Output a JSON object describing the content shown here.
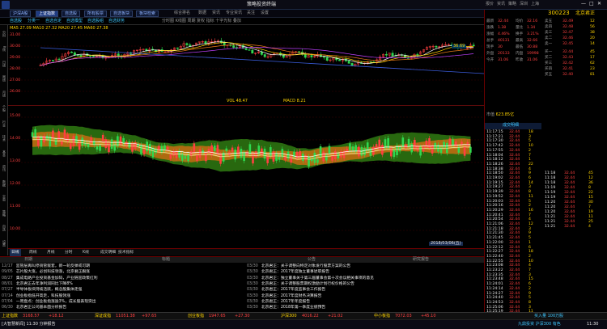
{
  "title_bar": {
    "app_title": "策略投资终端",
    "menus": [
      "报价",
      "资讯",
      "策略",
      "深圳",
      "上海"
    ]
  },
  "toolbar": {
    "buttons": [
      "沪深A股",
      "上证指数",
      "自选股",
      "所有股票",
      "自选板块",
      "板块检索"
    ],
    "active_index": 1,
    "right_items": [
      "综合排名",
      "数据",
      "资讯",
      "专业资讯",
      "关注",
      "设置"
    ]
  },
  "toolbar2": {
    "items": [
      "自选股",
      "分类一",
      "自选自定",
      "自选模型",
      "自选股组",
      "自选财务"
    ],
    "info": "分时图 K线图 周期 复权 指标 十字光标 叠加"
  },
  "left_panel": {
    "items": [
      "分时",
      "K线",
      "日线",
      "周线",
      "月线",
      "个股",
      "行业",
      "技术",
      "基本",
      "资讯",
      "数据",
      "交易",
      "策略",
      "自选",
      "设置"
    ]
  },
  "chart": {
    "indicator_text": "MA5 27.09 MA10 27.32 MA20 27.45 MA60 27.38",
    "top_right_value": "36.69",
    "mid_label": "VOL 48.47",
    "mid_label2": "MACD 8.21",
    "bottom_label": "2018/03/06(五)",
    "left_ticks": [
      "31.00",
      "30.00",
      "29.00",
      "28.00",
      "27.00",
      "26.00"
    ],
    "main_ticks": [
      "15.00",
      "14.00",
      "13.00",
      "12.00",
      "11.00",
      "10.00"
    ]
  },
  "bottom_tabs": [
    "日线",
    "周线",
    "月线",
    "分时",
    "K线",
    "成交明细",
    "技术指标"
  ],
  "right_panel": {
    "code": "300223",
    "name": "北京君正",
    "quote_rows": [
      {
        "label": "最新",
        "value": "32.44",
        "label2": "均价",
        "value2": "32.16"
      },
      {
        "label": "涨跌",
        "value": "1.38",
        "label2": "量比",
        "value2": "1.34"
      },
      {
        "label": "涨幅",
        "value": "4.46%",
        "label2": "换手",
        "value2": "3.21%"
      },
      {
        "label": "总手",
        "value": "40131",
        "label2": "最高",
        "value2": "32.66"
      },
      {
        "label": "现手",
        "value": "30",
        "label2": "最低",
        "value2": "30.88"
      },
      {
        "label": "外盘",
        "value": "20133",
        "label2": "内盘",
        "value2": "19998"
      },
      {
        "label": "今开",
        "value": "31.06",
        "label2": "昨收",
        "value2": "31.06"
      }
    ],
    "sell_orders": [
      {
        "label": "卖五",
        "price": "32.49",
        "vol": "12"
      },
      {
        "label": "卖四",
        "price": "32.48",
        "vol": "56"
      },
      {
        "label": "卖三",
        "price": "32.47",
        "vol": "38"
      },
      {
        "label": "卖二",
        "price": "32.46",
        "vol": "20"
      },
      {
        "label": "卖一",
        "price": "32.45",
        "vol": "14"
      }
    ],
    "buy_orders": [
      {
        "label": "买一",
        "price": "32.44",
        "vol": "45"
      },
      {
        "label": "买二",
        "price": "32.43",
        "vol": "17"
      },
      {
        "label": "买三",
        "price": "32.42",
        "vol": "62"
      },
      {
        "label": "买四",
        "price": "32.41",
        "vol": "23"
      },
      {
        "label": "买五",
        "price": "32.40",
        "vol": "81"
      }
    ],
    "capital": "623.85亿",
    "trades_header": "成交明细",
    "trades": [
      {
        "time": "11:17:15",
        "price": "32.44",
        "vol": "18"
      },
      {
        "time": "11:17:21",
        "price": "32.44",
        "vol": "3"
      },
      {
        "time": "11:17:30",
        "price": "32.44",
        "vol": "5"
      },
      {
        "time": "11:17:42",
        "price": "32.44",
        "vol": "10"
      },
      {
        "time": "11:17:55",
        "price": "32.44",
        "vol": "2"
      },
      {
        "time": "11:18:04",
        "price": "32.44",
        "vol": "7"
      },
      {
        "time": "11:18:12",
        "price": "32.44",
        "vol": "1"
      },
      {
        "time": "11:18:26",
        "price": "32.44",
        "vol": "22"
      },
      {
        "time": "11:18:38",
        "price": "32.44",
        "vol": "4"
      },
      {
        "time": "11:18:50",
        "price": "32.44",
        "vol": "9"
      },
      {
        "time": "11:19:02",
        "price": "32.44",
        "vol": "6"
      },
      {
        "time": "11:19:15",
        "price": "32.44",
        "vol": "14"
      },
      {
        "time": "11:19:27",
        "price": "32.44",
        "vol": "3"
      },
      {
        "time": "11:19:39",
        "price": "32.44",
        "vol": "8"
      },
      {
        "time": "11:19:52",
        "price": "32.44",
        "vol": "11"
      },
      {
        "time": "11:20:03",
        "price": "32.44",
        "vol": "5"
      },
      {
        "time": "11:20:16",
        "price": "32.44",
        "vol": "2"
      },
      {
        "time": "11:20:29",
        "price": "32.44",
        "vol": "16"
      },
      {
        "time": "11:20:41",
        "price": "32.44",
        "vol": "7"
      },
      {
        "time": "11:20:54",
        "price": "32.44",
        "vol": "4"
      },
      {
        "time": "11:21:06",
        "price": "32.44",
        "vol": "12"
      },
      {
        "time": "11:21:18",
        "price": "32.44",
        "vol": "3"
      },
      {
        "time": "11:21:30",
        "price": "32.44",
        "vol": "9"
      },
      {
        "time": "11:21:45",
        "price": "32.44",
        "vol": "5"
      },
      {
        "time": "11:22:00",
        "price": "32.44",
        "vol": "1"
      },
      {
        "time": "11:22:12",
        "price": "32.44",
        "vol": "6"
      },
      {
        "time": "11:22:27",
        "price": "32.44",
        "vol": "18"
      },
      {
        "time": "11:22:40",
        "price": "32.44",
        "vol": "2"
      },
      {
        "time": "11:22:55",
        "price": "32.44",
        "vol": "10"
      },
      {
        "time": "11:23:08",
        "price": "32.44",
        "vol": "4"
      },
      {
        "time": "11:23:22",
        "price": "32.44",
        "vol": "7"
      },
      {
        "time": "11:23:35",
        "price": "32.44",
        "vol": "3"
      },
      {
        "time": "11:23:48",
        "price": "32.44",
        "vol": "15"
      },
      {
        "time": "11:24:01",
        "price": "32.44",
        "vol": "6"
      },
      {
        "time": "11:24:14",
        "price": "32.44",
        "vol": "2"
      },
      {
        "time": "11:24:27",
        "price": "32.44",
        "vol": "9"
      },
      {
        "time": "11:24:40",
        "price": "32.44",
        "vol": "5"
      },
      {
        "time": "11:24:53",
        "price": "32.44",
        "vol": "8"
      },
      {
        "time": "11:25:06",
        "price": "32.44",
        "vol": "3"
      },
      {
        "time": "11:25:19",
        "price": "32.44",
        "vol": "11"
      }
    ],
    "right_trades": [
      {
        "time": "11:18",
        "price": "32.44",
        "vol": "45"
      },
      {
        "time": "11:18",
        "price": "32.44",
        "vol": "12"
      },
      {
        "time": "11:18",
        "price": "32.44",
        "vol": "36"
      },
      {
        "time": "11:19",
        "price": "32.44",
        "vol": "8"
      },
      {
        "time": "11:19",
        "price": "32.44",
        "vol": "22"
      },
      {
        "time": "11:19",
        "price": "32.44",
        "vol": "15"
      },
      {
        "time": "11:20",
        "price": "32.44",
        "vol": "30"
      },
      {
        "time": "11:20",
        "price": "32.44",
        "vol": "7"
      },
      {
        "time": "11:20",
        "price": "32.44",
        "vol": "19"
      },
      {
        "time": "11:21",
        "price": "32.44",
        "vol": "11"
      },
      {
        "time": "11:21",
        "price": "32.44",
        "vol": "25"
      },
      {
        "time": "11:21",
        "price": "32.44",
        "vol": "4"
      }
    ]
  },
  "news": {
    "headers": [
      "日期",
      "标题",
      "公告",
      "研究报告"
    ],
    "left": [
      {
        "date": "12/17",
        "text": "监管层再叫停资管嵌套，新一轮反弹或可期"
      },
      {
        "date": "09/05",
        "text": "芯片股大涨，必创科技领涨，北京君正跟涨"
      },
      {
        "date": "08/27",
        "text": "集成电路产业投资基金加码，产业链迎政策红利"
      },
      {
        "date": "08/01",
        "text": "北京君正去年净利润同比下降8%"
      },
      {
        "date": "07/27",
        "text": "半导体板块持续活跃，概念股集体走强"
      },
      {
        "date": "07/14",
        "text": "创业板指低开高走，科技股领涨"
      },
      {
        "date": "07/04",
        "text": "一周盘点：创业板指涨逾3%，成长股表现突出"
      },
      {
        "date": "06/30",
        "text": "北京君正公司基本面分析报告"
      }
    ],
    "right": [
      {
        "date": "03/30",
        "text": "北京君正：关于调整向特定对象发行股票方案的公告"
      },
      {
        "date": "03/30",
        "text": "北京君正：2017年度独立董事述职报告"
      },
      {
        "date": "03/30",
        "text": "北京君正：独立董事关于第三届董事会第十次会议相关事项的意见"
      },
      {
        "date": "03/30",
        "text": "北京君正：关于调整股票期权激励计划行权价格的公告"
      },
      {
        "date": "03/30",
        "text": "北京君正：2017年度监事会工作报告"
      },
      {
        "date": "03/30",
        "text": "北京君正：2017年度财务决算报告"
      },
      {
        "date": "03/30",
        "text": "北京君正：2017年年度报告"
      },
      {
        "date": "03/30",
        "text": "北京君正：2018年第一季度业绩预告"
      }
    ]
  },
  "status_bar": {
    "items": [
      {
        "label": "上证指数",
        "value": "3168.57",
        "change": "+18.12"
      },
      {
        "label": "深证成指",
        "value": "11051.38",
        "change": "+97.65"
      },
      {
        "label": "创业板指",
        "value": "1947.65",
        "change": "+27.30"
      },
      {
        "label": "沪深300",
        "value": "4016.22",
        "change": "+21.02"
      },
      {
        "label": "中小板指",
        "value": "7072.03",
        "change": "+45.10"
      }
    ],
    "right_text": "买入量 100万股"
  },
  "taskbar": {
    "notification": "[大智慧新闻] 11:30 分钟报告",
    "time": "11:30",
    "right_info": "九鼎投资 沪深300 有色"
  },
  "colors": {
    "up": "#ff4040",
    "down": "#2fd84f",
    "ma1": "#ffffff",
    "ma2": "#ffd400",
    "ma3": "#e97a16",
    "band_green": "#2f7a12",
    "band_orange": "#c46c10"
  }
}
